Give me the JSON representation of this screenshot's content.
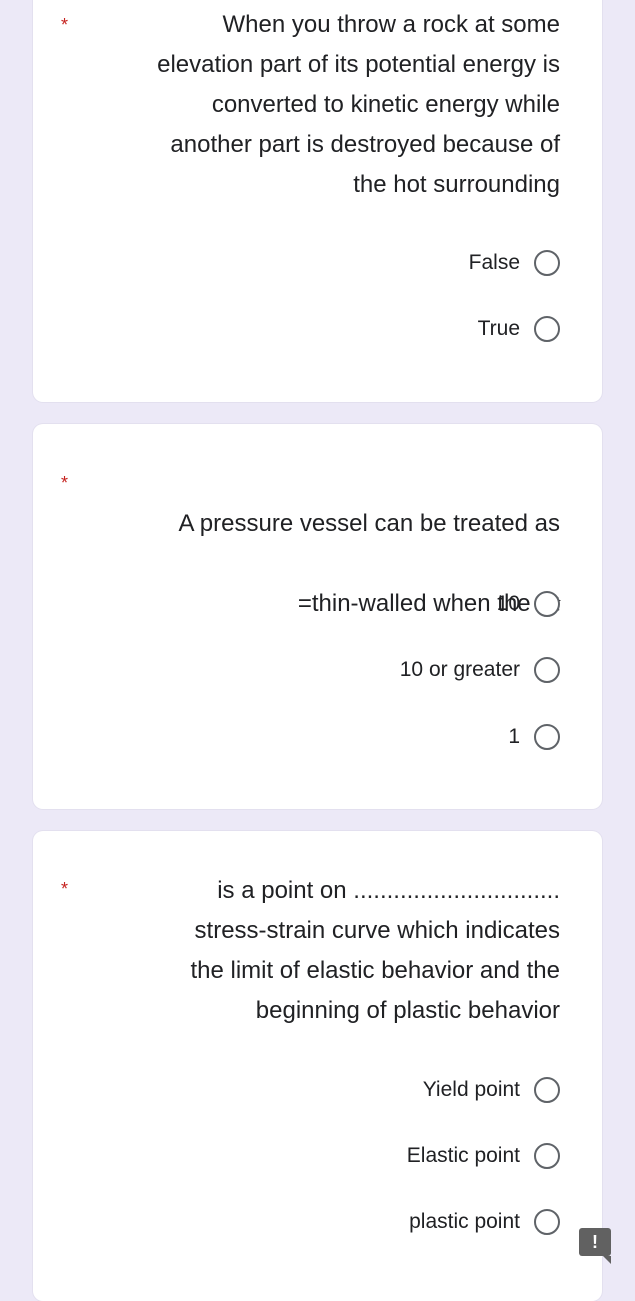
{
  "theme": {
    "background": "#ece9f7",
    "card": "#ffffff",
    "required_asterisk": "#c5221f",
    "radio_border": "#5f6368"
  },
  "questions": [
    {
      "required_mark": "*",
      "text": "When you throw a rock at some\nelevation part of its potential energy is\nconverted to kinetic energy while\nanother part is destroyed because of\nthe hot surrounding",
      "options": [
        {
          "label": "False",
          "selected": false
        },
        {
          "label": "True",
          "selected": false
        }
      ]
    },
    {
      "required_mark": "*",
      "text_line1": "A pressure vessel can be treated as",
      "text_line2_prefix": "=thin-walled when the ",
      "text_line2_italic": "r/t",
      "options": [
        {
          "label": "10",
          "selected": false
        },
        {
          "label": "10 or greater",
          "selected": false
        },
        {
          "label": "1",
          "selected": false
        }
      ]
    },
    {
      "required_mark": "*",
      "text": "is a point on ...............................\nstress-strain curve which indicates\nthe limit of elastic behavior and the\nbeginning of plastic behavior",
      "options": [
        {
          "label": "Yield point",
          "selected": false
        },
        {
          "label": "Elastic point",
          "selected": false
        },
        {
          "label": "plastic point",
          "selected": false
        }
      ]
    }
  ],
  "report_button": {
    "icon": "exclamation-icon",
    "glyph": "!"
  }
}
